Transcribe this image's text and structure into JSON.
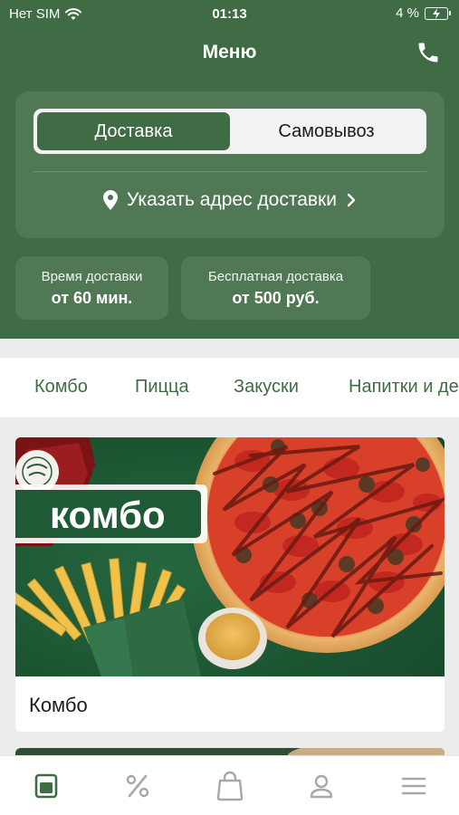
{
  "status_bar": {
    "carrier": "Нет SIM",
    "time": "01:13",
    "battery": "4 %"
  },
  "nav": {
    "title": "Меню"
  },
  "delivery_mode": {
    "options": [
      "Доставка",
      "Самовывоз"
    ],
    "selected": "Доставка",
    "address_prompt": "Указать адрес доставки"
  },
  "info": [
    {
      "label": "Время доставки",
      "value": "от 60 мин."
    },
    {
      "label": "Бесплатная доставка",
      "value": "от 500 руб."
    }
  ],
  "categories": [
    "Комбо",
    "Пицца",
    "Закуски",
    "Напитки и де"
  ],
  "promo": {
    "banner_text": "комбо",
    "title": "Комбо"
  },
  "tab_bar": {
    "items": [
      "menu-icon",
      "percent-icon",
      "bag-icon",
      "profile-icon",
      "hamburger-icon"
    ],
    "active": "menu-icon"
  },
  "colors": {
    "brand_green": "#3f6b45",
    "banner_green": "#1f5a36"
  }
}
